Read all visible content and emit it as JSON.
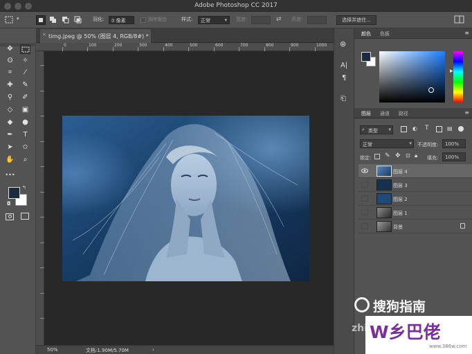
{
  "app": {
    "title": "Adobe Photoshop CC 2017"
  },
  "options_bar": {
    "feather_label": "羽化:",
    "feather_value": "0 像素",
    "antialias_label": "消除锯齿",
    "style_label": "样式:",
    "style_value": "正常",
    "width_label": "宽度:",
    "height_label": "高度:",
    "select_mask_label": "选择并遮住..."
  },
  "document": {
    "tab_title": "timg.jpeg @ 50% (图层 4, RGB/8#) *",
    "ruler_labels": [
      "0",
      "100",
      "200",
      "300",
      "400",
      "500",
      "600",
      "700",
      "800",
      "900",
      "1000"
    ],
    "zoom": "50%",
    "doc_info": "文档:1.90M/5.70M"
  },
  "color_panel": {
    "tabs": [
      "颜色",
      "色板"
    ]
  },
  "layers_panel": {
    "tabs": [
      "图层",
      "通道",
      "路径"
    ],
    "filter_kind": "类型",
    "blend_mode": "正常",
    "opacity_label": "不透明度:",
    "opacity_value": "100%",
    "lock_label": "锁定:",
    "fill_label": "填充:",
    "fill_value": "100%",
    "layers": [
      {
        "name": "图层 4",
        "visible": true,
        "selected": true,
        "locked": false
      },
      {
        "name": "图层 3",
        "visible": false,
        "selected": false,
        "locked": false
      },
      {
        "name": "图层 2",
        "visible": false,
        "selected": false,
        "locked": false
      },
      {
        "name": "图层 1",
        "visible": false,
        "selected": false,
        "locked": false
      },
      {
        "name": "背景",
        "visible": false,
        "selected": false,
        "locked": true
      }
    ]
  },
  "watermarks": {
    "sogou": "搜狗指南",
    "zhi": "zhi",
    "site_logo": "W乡巴佬",
    "site_url": "www.386w.com"
  },
  "colors": {
    "foreground": "#1b2c3f",
    "background": "#ffffff",
    "accent": "#4a85c8"
  }
}
